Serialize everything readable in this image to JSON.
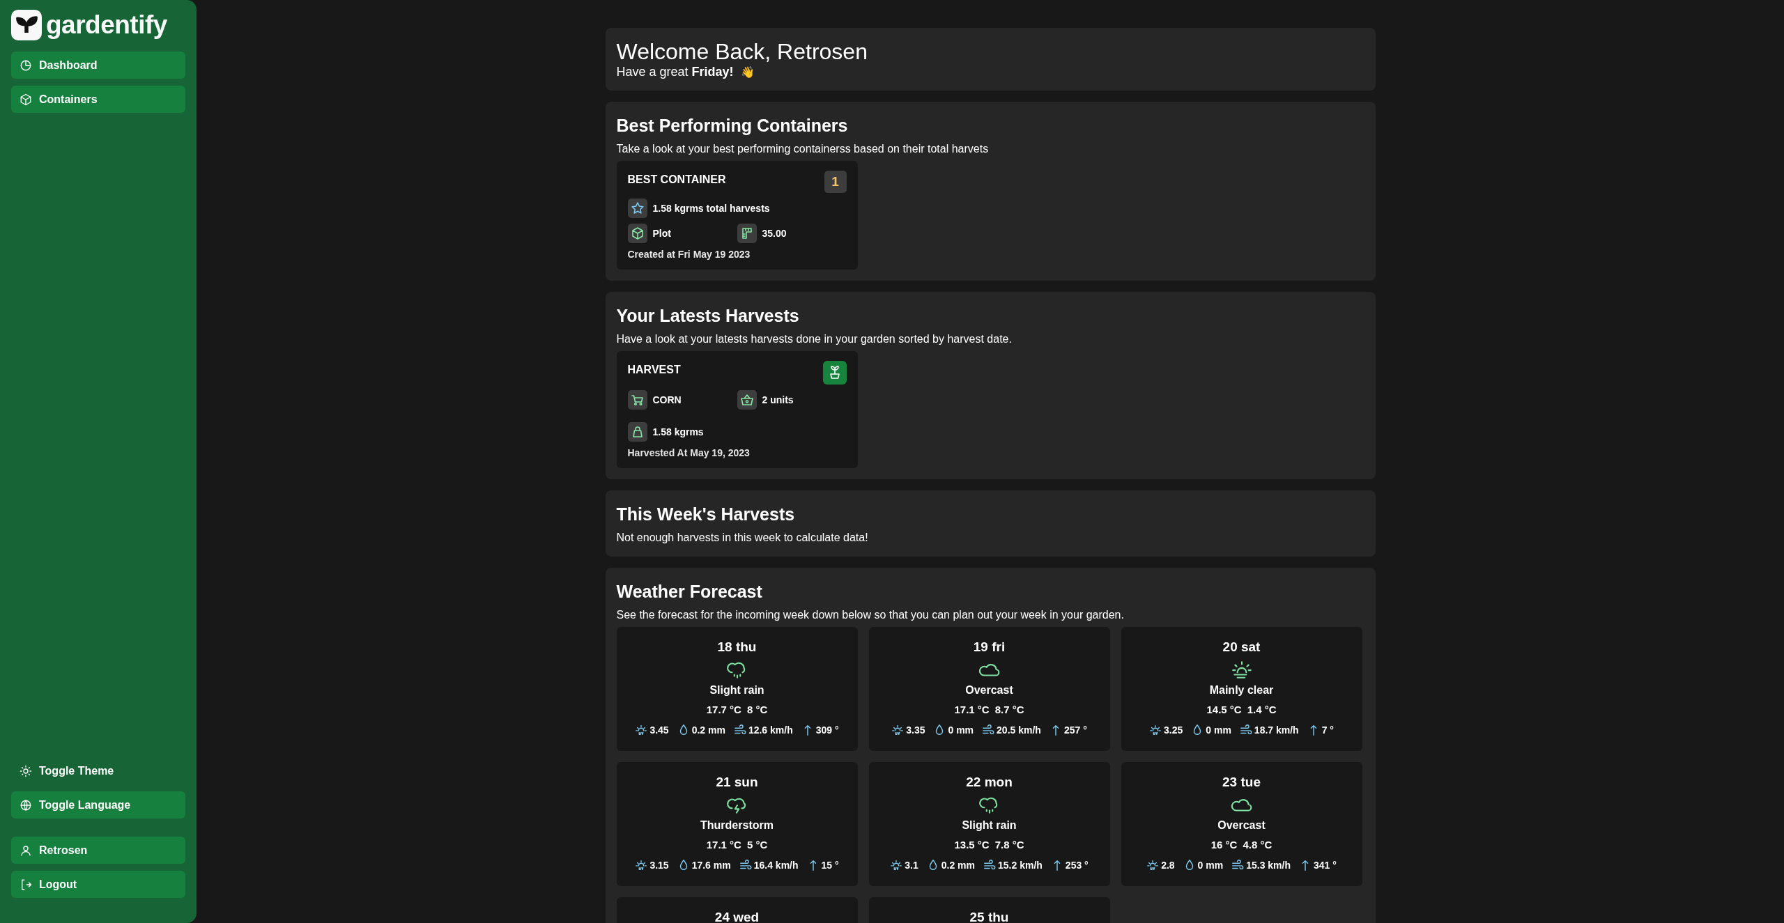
{
  "sidebar": {
    "logo": "gardentify",
    "nav": [
      {
        "label": "Dashboard"
      },
      {
        "label": "Containers"
      }
    ],
    "settings": [
      {
        "label": "Toggle Theme",
        "kind": "plain"
      },
      {
        "label": "Toggle Language",
        "kind": "filled"
      }
    ],
    "account": [
      {
        "label": "Retrosen"
      },
      {
        "label": "Logout"
      }
    ]
  },
  "welcome": {
    "title": "Welcome Back, Retrosen",
    "subtitle": "Have a great **Friday!**",
    "emoji": "👋"
  },
  "best_containers": {
    "title": "Best Performing Containers",
    "description": "Take a look at your best performing containerss based on their total harvets",
    "card": {
      "heading": "BEST CONTAINER",
      "rank": "1",
      "total": "1.58 kgrms total harvests",
      "type": "Plot",
      "area": "35.00",
      "created": "Created at Fri May 19 2023"
    }
  },
  "latest_harvests": {
    "title": "Your Latests Harvests",
    "description": "Have a look at your latests harvests done in your garden sorted by harvest date.",
    "card": {
      "heading": "HARVEST",
      "crop": "CORN",
      "quantity": "2 units",
      "weight": "1.58 kgrms",
      "date": "Harvested At May 19, 2023"
    }
  },
  "week_harvests": {
    "title": "This Week's Harvests",
    "message": "Not enough harvests in this week to calculate data!"
  },
  "weather": {
    "title": "Weather Forecast",
    "description": "See the forecast for the incoming week down below so that you can plan out your week in your garden.",
    "days": [
      {
        "day": "18 thu",
        "kind": "rain",
        "condition": "Slight rain",
        "max": "17.7 °C",
        "min": "8 °C",
        "uv": "3.45",
        "rain": "0.2 mm",
        "wind": "12.6 km/h",
        "direction": "309 °"
      },
      {
        "day": "19 fri",
        "kind": "cloud",
        "condition": "Overcast",
        "max": "17.1 °C",
        "min": "8.7 °C",
        "uv": "3.35",
        "rain": "0 mm",
        "wind": "20.5 km/h",
        "direction": "257 °"
      },
      {
        "day": "20 sat",
        "kind": "sun",
        "condition": "Mainly clear",
        "max": "14.5 °C",
        "min": "1.4 °C",
        "uv": "3.25",
        "rain": "0 mm",
        "wind": "18.7 km/h",
        "direction": "7 °"
      },
      {
        "day": "21 sun",
        "kind": "storm",
        "condition": "Thurderstorm",
        "max": "17.1 °C",
        "min": "5 °C",
        "uv": "3.15",
        "rain": "17.6 mm",
        "wind": "16.4 km/h",
        "direction": "15 °"
      },
      {
        "day": "22 mon",
        "kind": "rain",
        "condition": "Slight rain",
        "max": "13.5 °C",
        "min": "7.8 °C",
        "uv": "3.1",
        "rain": "0.2 mm",
        "wind": "15.2 km/h",
        "direction": "253 °"
      },
      {
        "day": "23 tue",
        "kind": "cloud",
        "condition": "Overcast",
        "max": "16 °C",
        "min": "4.8 °C",
        "uv": "2.8",
        "rain": "0 mm",
        "wind": "15.3 km/h",
        "direction": "341 °"
      },
      {
        "day": "24 wed"
      },
      {
        "day": "25 thu"
      }
    ]
  }
}
